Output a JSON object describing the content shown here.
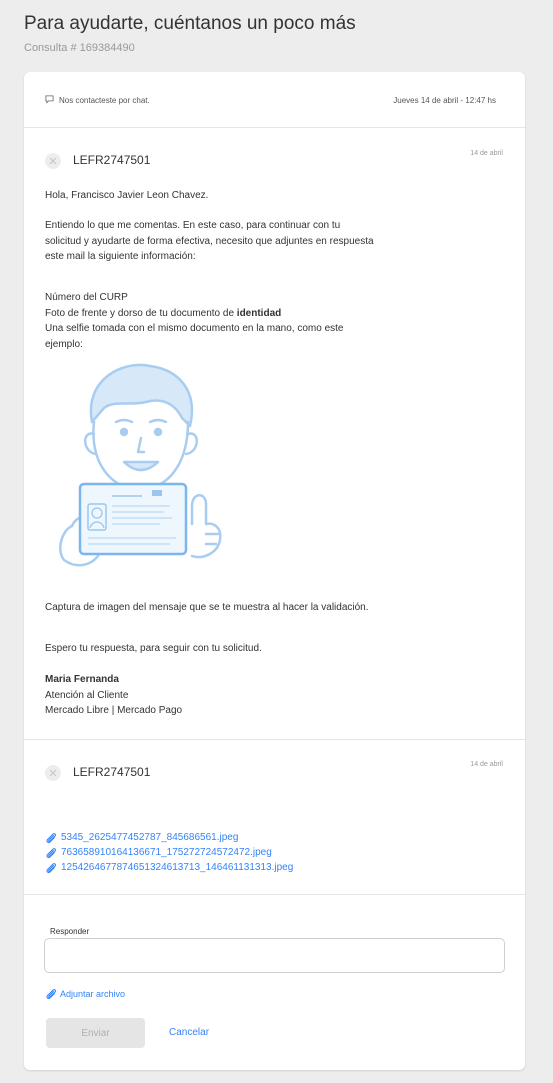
{
  "header": {
    "title": "Para ayudarte, cuéntanos un poco más",
    "subtitle": "Consulta # 169384490"
  },
  "contact": {
    "text": "Nos contacteste por chat.",
    "date": "Jueves 14 de abril - 12:47 hs",
    "icon": "chat-bubble-icon"
  },
  "messages": [
    {
      "sender": "LEFR2747501",
      "date": "14 de abril",
      "body": {
        "greeting": "Hola, Francisco Javier Leon Chavez.",
        "para1": [
          "Entiendo lo que me comentas. En este caso, para continuar con tu",
          "solicitud y ayudarte de forma efectiva, necesito que adjuntes en respuesta",
          "este mail la siguiente información:"
        ],
        "req_curp": "Número del CURP",
        "req_photo_prefix": "Foto de frente y dorso de tu documento de ",
        "req_photo_bold": "identidad",
        "req_selfie": [
          "Una selfie tomada con el mismo documento en la mano, como este",
          "ejemplo:"
        ],
        "capture": "Captura de imagen del mensaje que se te muestra al hacer la validación.",
        "closing": "Espero tu respuesta, para seguir con tu solicitud.",
        "signature_name": "Maria Fernanda",
        "signature_role": "Atención al Cliente",
        "signature_company": "Mercado Libre | Mercado Pago"
      }
    },
    {
      "sender": "LEFR2747501",
      "date": "14 de abril",
      "attachments": [
        "5345_2625477452787_845686561.jpeg",
        "763658910164136671_175272724572472.jpeg",
        "1254264677874651324613713_146461131313.jpeg"
      ]
    }
  ],
  "reply": {
    "label": "Responder",
    "value": "",
    "attach_label": "Adjuntar archivo",
    "send_label": "Enviar",
    "cancel_label": "Cancelar"
  },
  "colors": {
    "link": "#3483fa",
    "illustration": "#a9cdf0"
  }
}
